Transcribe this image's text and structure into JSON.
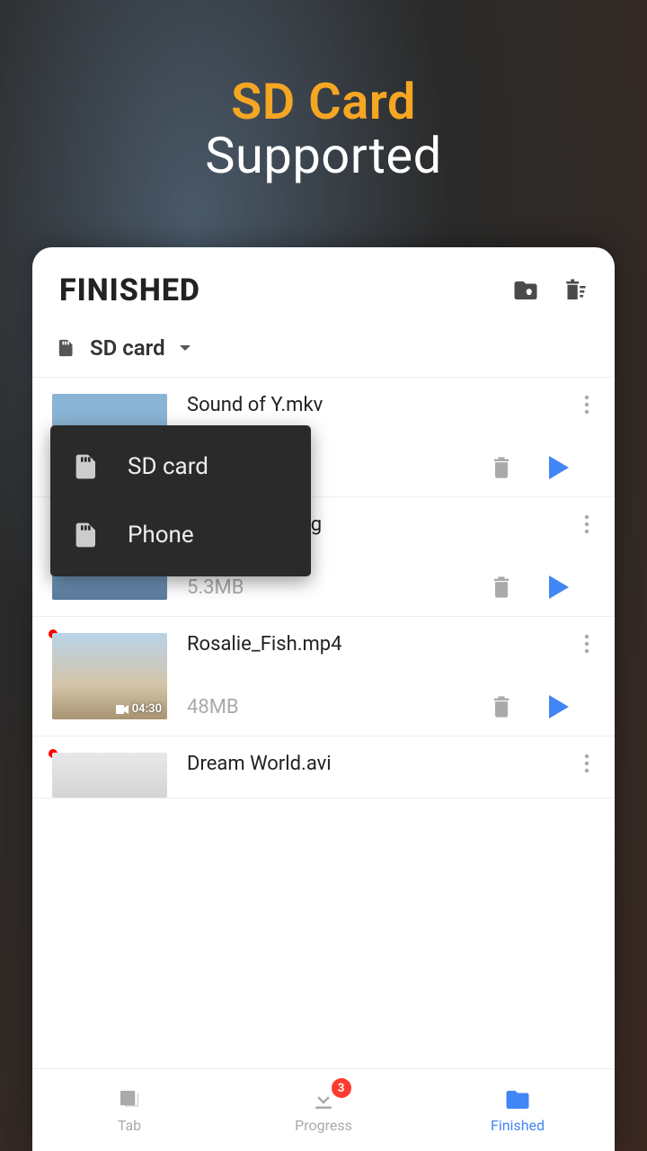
{
  "hero": {
    "title": "SD Card",
    "subtitle": "Supported"
  },
  "header": {
    "title": "FINISHED"
  },
  "filter": {
    "selected": "SD card"
  },
  "dropdown": {
    "items": [
      {
        "label": "SD card"
      },
      {
        "label": "Phone"
      }
    ]
  },
  "files": [
    {
      "name": "Sound of Y.mkv",
      "size": "",
      "duration": "",
      "new": false,
      "type": "video"
    },
    {
      "name": "Saint Island.jpg",
      "size": "5.3MB",
      "duration": "",
      "new": false,
      "type": "image"
    },
    {
      "name": "Rosalie_Fish.mp4",
      "size": "48MB",
      "duration": "04:30",
      "new": true,
      "type": "video"
    },
    {
      "name": "Dream World.avi",
      "size": "",
      "duration": "",
      "new": true,
      "type": "video"
    }
  ],
  "nav": {
    "tab": "Tab",
    "progress": "Progress",
    "progress_badge": "3",
    "finished": "Finished"
  }
}
